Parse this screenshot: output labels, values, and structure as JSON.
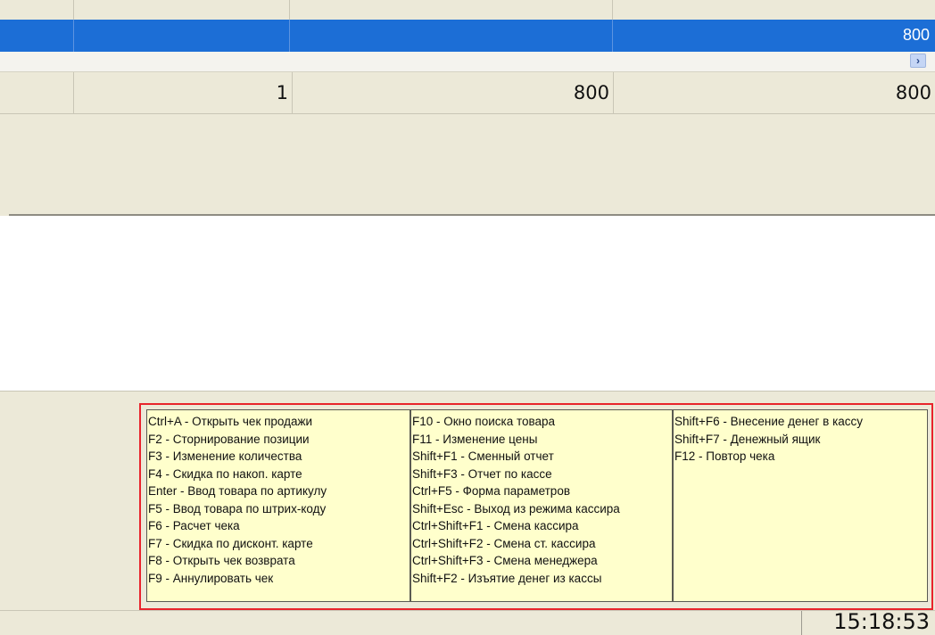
{
  "grid": {
    "selected_row": {
      "value": "800"
    },
    "totals_row": {
      "quantity": "1",
      "price": "800",
      "sum": "800"
    }
  },
  "scroll": {
    "right_arrow_icon": "chevron-right-icon"
  },
  "hotkeys": {
    "col1": [
      "Ctrl+A - Открыть чек продажи",
      "F2 - Сторнирование позиции",
      "F3 - Изменение количества",
      "F4 - Скидка по накоп. карте",
      "Enter - Ввод товара по артикулу",
      "F5 - Ввод товара по штрих-коду",
      "F6 - Расчет чека",
      "F7 - Скидка по дисконт. карте",
      "F8 - Открыть чек возврата",
      "F9 - Аннулировать чек"
    ],
    "col2": [
      "F10 - Окно поиска товара",
      "F11 - Изменение цены",
      "Shift+F1 - Сменный отчет",
      "Shift+F3 - Отчет по кассе",
      "Ctrl+F5 - Форма параметров",
      "Shift+Esc - Выход из режима кассира",
      "Ctrl+Shift+F1 - Смена кассира",
      "Ctrl+Shift+F2 - Смена ст. кассира",
      "Ctrl+Shift+F3 - Смена менеджера",
      "Shift+F2 - Изъятие денег из кассы"
    ],
    "col3": [
      "Shift+F6 - Внесение денег в кассу",
      "Shift+F7 - Денежный ящик",
      "F12 - Повтор чека"
    ]
  },
  "status": {
    "clock": "15:18:53"
  },
  "colors": {
    "selection": "#1c6ed6",
    "hotkey_bg": "#ffffcc",
    "highlight_border": "#e8242c"
  }
}
